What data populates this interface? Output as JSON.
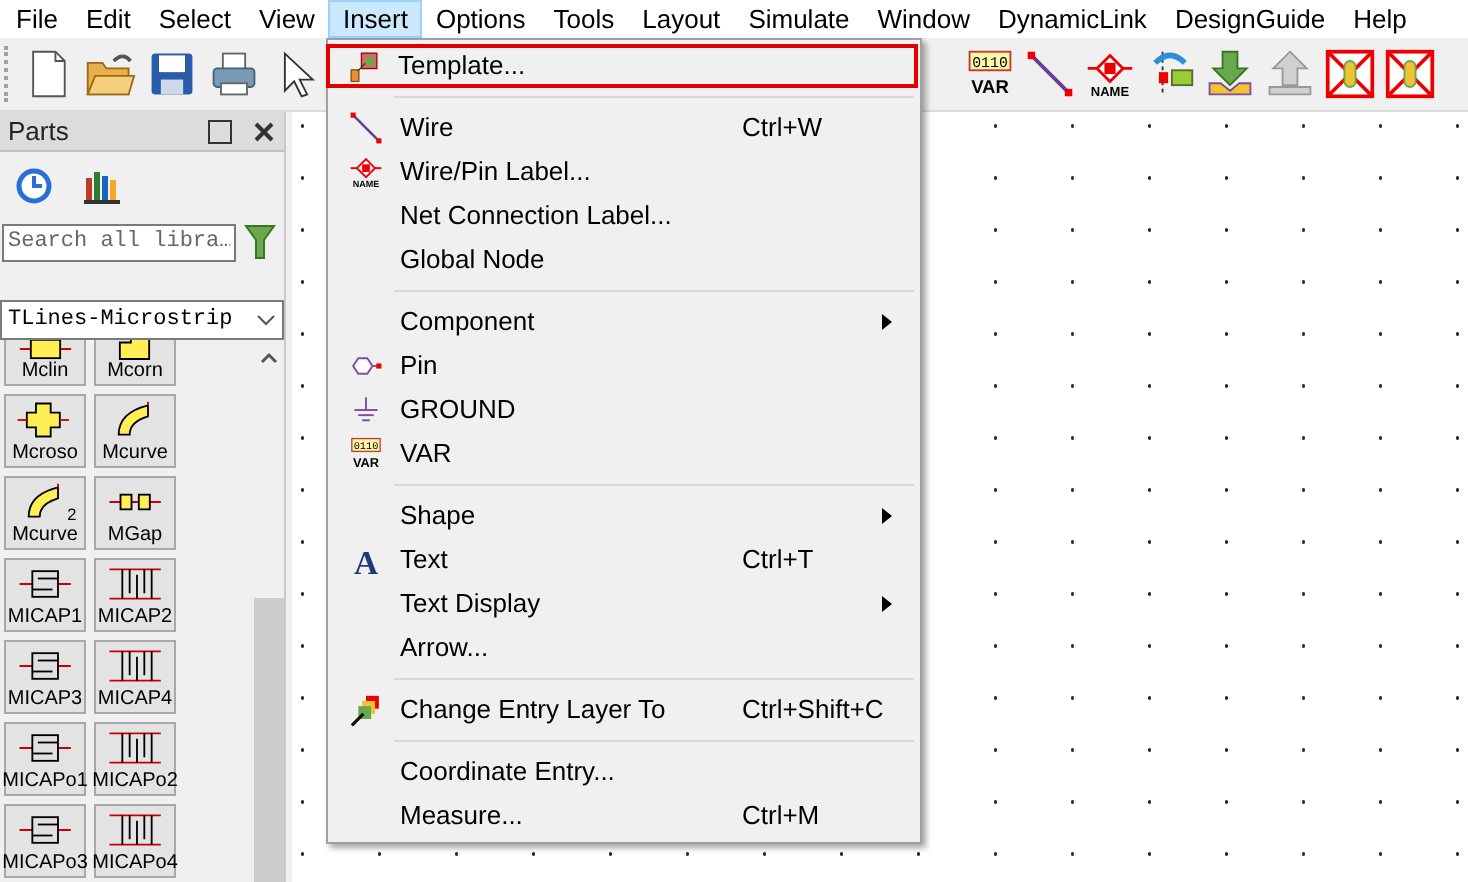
{
  "menubar": [
    {
      "label": "File",
      "selected": false
    },
    {
      "label": "Edit",
      "selected": false
    },
    {
      "label": "Select",
      "selected": false
    },
    {
      "label": "View",
      "selected": false
    },
    {
      "label": "Insert",
      "selected": true
    },
    {
      "label": "Options",
      "selected": false
    },
    {
      "label": "Tools",
      "selected": false
    },
    {
      "label": "Layout",
      "selected": false
    },
    {
      "label": "Simulate",
      "selected": false
    },
    {
      "label": "Window",
      "selected": false
    },
    {
      "label": "DynamicLink",
      "selected": false
    },
    {
      "label": "DesignGuide",
      "selected": false
    },
    {
      "label": "Help",
      "selected": false
    }
  ],
  "toolbar_left": [
    {
      "kind": "new"
    },
    {
      "kind": "open"
    },
    {
      "kind": "save"
    },
    {
      "kind": "print"
    },
    {
      "kind": "pointer"
    }
  ],
  "toolbar_right": [
    {
      "kind": "var",
      "icon_text": [
        "0110",
        "VAR"
      ]
    },
    {
      "kind": "wire"
    },
    {
      "kind": "name",
      "icon_text": [
        "NAME"
      ]
    },
    {
      "kind": "port"
    },
    {
      "kind": "download"
    },
    {
      "kind": "upload"
    },
    {
      "kind": "delete"
    },
    {
      "kind": "delete"
    }
  ],
  "parts_panel": {
    "title": "Parts",
    "search": {
      "placeholder": "Search all libra…"
    },
    "library": "TLines-Microstrip",
    "parts": [
      {
        "label": "Mclin",
        "kind": "line"
      },
      {
        "label": "Mcorn",
        "kind": "corner"
      },
      {
        "label": "Mcroso",
        "kind": "cross"
      },
      {
        "label": "Mcurve",
        "kind": "curve"
      },
      {
        "label": "Mcurve",
        "kind": "curve",
        "icon_text": "2"
      },
      {
        "label": "MGap",
        "kind": "gap"
      },
      {
        "label": "MICAP1",
        "kind": "cap"
      },
      {
        "label": "MICAP2",
        "kind": "comb"
      },
      {
        "label": "MICAP3",
        "kind": "cap"
      },
      {
        "label": "MICAP4",
        "kind": "comb"
      },
      {
        "label": "MICAPo1",
        "kind": "cap"
      },
      {
        "label": "MICAPo2",
        "kind": "comb"
      },
      {
        "label": "MICAPo3",
        "kind": "cap"
      },
      {
        "label": "MICAPo4",
        "kind": "comb"
      }
    ]
  },
  "insert_menu": [
    {
      "kind": "template",
      "label": "Template...",
      "highlighted": true
    },
    {
      "kind": "separator"
    },
    {
      "kind": "wire",
      "label": "Wire",
      "shortcut": "Ctrl+W"
    },
    {
      "kind": "name",
      "label": "Wire/Pin Label...",
      "icon_text": [
        "NAME"
      ]
    },
    {
      "kind": "plain",
      "label": "Net Connection Label..."
    },
    {
      "kind": "plain",
      "label": "Global Node"
    },
    {
      "kind": "separator"
    },
    {
      "kind": "plain",
      "label": "Component",
      "submenu": true
    },
    {
      "kind": "pin",
      "label": "Pin"
    },
    {
      "kind": "ground",
      "label": "GROUND"
    },
    {
      "kind": "var",
      "label": "VAR",
      "icon_text": [
        "0110",
        "VAR"
      ]
    },
    {
      "kind": "separator"
    },
    {
      "kind": "plain",
      "label": "Shape",
      "submenu": true
    },
    {
      "kind": "text",
      "label": "Text",
      "icon_text": [
        "A"
      ],
      "shortcut": "Ctrl+T"
    },
    {
      "kind": "plain",
      "label": "Text Display",
      "submenu": true
    },
    {
      "kind": "plain",
      "label": "Arrow..."
    },
    {
      "kind": "separator"
    },
    {
      "kind": "layer",
      "label": "Change Entry Layer To",
      "shortcut": "Ctrl+Shift+C"
    },
    {
      "kind": "separator"
    },
    {
      "kind": "plain",
      "label": "Coordinate Entry..."
    },
    {
      "kind": "plain",
      "label": "Measure...",
      "shortcut": "Ctrl+M"
    }
  ]
}
